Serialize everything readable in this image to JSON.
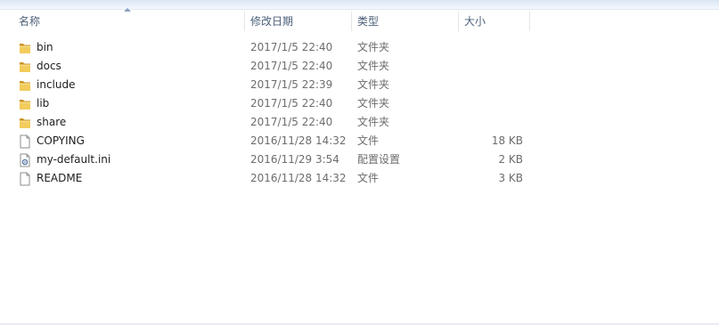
{
  "columns": {
    "name": "名称",
    "date": "修改日期",
    "type": "类型",
    "size": "大小"
  },
  "files": [
    {
      "name": "bin",
      "date": "2017/1/5 22:40",
      "type": "文件夹",
      "size": "",
      "icon": "folder-icon"
    },
    {
      "name": "docs",
      "date": "2017/1/5 22:40",
      "type": "文件夹",
      "size": "",
      "icon": "folder-icon"
    },
    {
      "name": "include",
      "date": "2017/1/5 22:39",
      "type": "文件夹",
      "size": "",
      "icon": "folder-icon"
    },
    {
      "name": "lib",
      "date": "2017/1/5 22:40",
      "type": "文件夹",
      "size": "",
      "icon": "folder-icon"
    },
    {
      "name": "share",
      "date": "2017/1/5 22:40",
      "type": "文件夹",
      "size": "",
      "icon": "folder-icon"
    },
    {
      "name": "COPYING",
      "date": "2016/11/28 14:32",
      "type": "文件",
      "size": "18 KB",
      "icon": "file-icon"
    },
    {
      "name": "my-default.ini",
      "date": "2016/11/29 3:54",
      "type": "配置设置",
      "size": "2 KB",
      "icon": "settings-file-icon"
    },
    {
      "name": "README",
      "date": "2016/11/28 14:32",
      "type": "文件",
      "size": "3 KB",
      "icon": "file-icon"
    }
  ],
  "colors": {
    "header_text": "#4c607a",
    "folder": "#e9bd4c",
    "folder_dark": "#c9952b"
  }
}
